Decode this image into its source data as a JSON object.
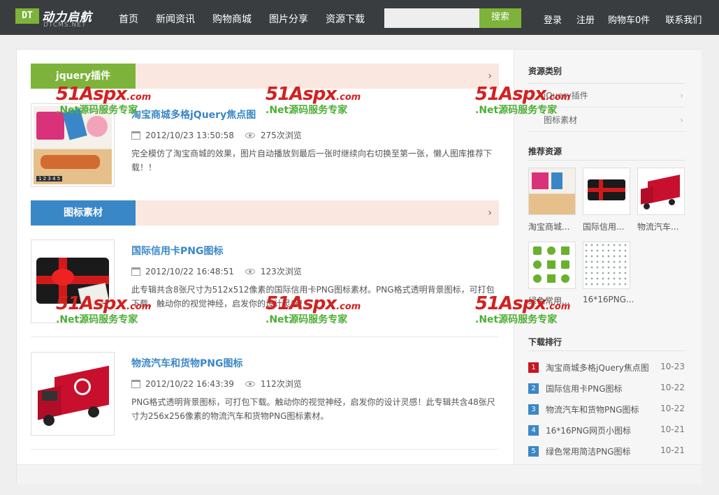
{
  "header": {
    "logo_box": "DT",
    "logo_cn": "动力启航",
    "logo_en": "DTCMS.NET",
    "nav": [
      "首页",
      "新闻资讯",
      "购物商城",
      "图片分享",
      "资源下载"
    ],
    "search_button": "搜索",
    "search_placeholder": "",
    "login": "登录",
    "register": "注册",
    "cart": "购物车0件",
    "contact": "联系我们"
  },
  "categories": [
    {
      "label": "jquery插件",
      "color": "#7db33a"
    },
    {
      "label": "图标素材",
      "color": "#3a87c8"
    }
  ],
  "items": [
    {
      "title": "淘宝商城多格jQuery焦点图",
      "date": "2012/10/23 13:50:58",
      "views": "275次浏览",
      "desc": "完全模仿了淘宝商城的效果，图片自动播放到最后一张时继续向右切换至第一张，懒人图库推荐下载！！"
    },
    {
      "title": "国际信用卡PNG图标",
      "date": "2012/10/22 16:48:51",
      "views": "123次浏览",
      "desc": "此专辑共含8张尺寸为512x512像素的国际信用卡PNG图标素材。PNG格式透明背景图标，可打包下载。触动你的视觉神经，启发你的设计灵感！"
    },
    {
      "title": "物流汽车和货物PNG图标",
      "date": "2012/10/22 16:43:39",
      "views": "112次浏览",
      "desc": "PNG格式透明背景图标，可打包下载。触动你的视觉神经，启发你的设计灵感！此专辑共含48张尺寸为256x256像素的物流汽车和货物PNG图标素材。"
    }
  ],
  "sidebar": {
    "cat_title": "资源类别",
    "cats": [
      "jQuery插件",
      "图标素材"
    ],
    "rec_title": "推荐资源",
    "recs": [
      "淘宝商城...",
      "国际信用...",
      "物流汽车...",
      "绿色常用...",
      "16*16PNG..."
    ],
    "rank_title": "下载排行",
    "ranks": [
      {
        "num": "1",
        "title": "淘宝商城多格jQuery焦点图",
        "date": "10-23",
        "color": "#c81623"
      },
      {
        "num": "2",
        "title": "国际信用卡PNG图标",
        "date": "10-22",
        "color": "#3a87c8"
      },
      {
        "num": "3",
        "title": "物流汽车和货物PNG图标",
        "date": "10-22",
        "color": "#3a87c8"
      },
      {
        "num": "4",
        "title": "16*16PNG网页小图标",
        "date": "10-21",
        "color": "#3a87c8"
      },
      {
        "num": "5",
        "title": "绿色常用简洁PNG图标",
        "date": "10-21",
        "color": "#3a87c8"
      }
    ]
  },
  "watermark": {
    "brand": "51Aspx",
    "domain": ".com",
    "slogan": ".Net源码服务专家"
  },
  "thumb_page_numbers": "1 2 3 4 5"
}
